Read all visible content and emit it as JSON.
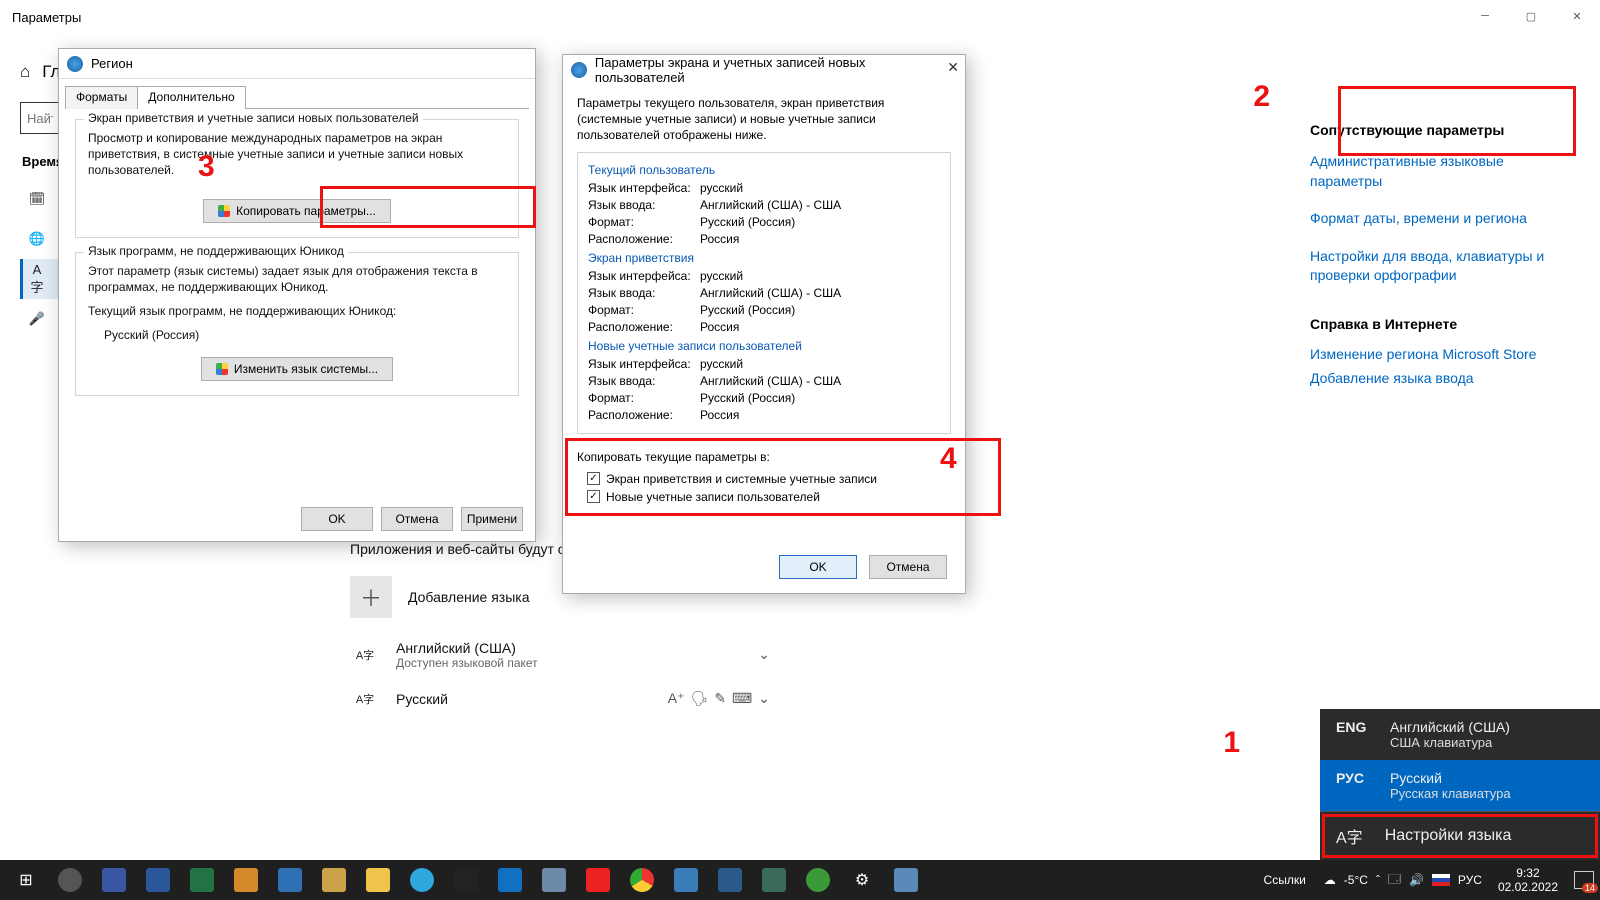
{
  "window": {
    "title": "Параметры",
    "home": "Гл"
  },
  "search": {
    "placeholder": "Найт"
  },
  "nav_heading": "Время",
  "nav": {
    "date": "Да",
    "region": "Ре",
    "lang": "Яз",
    "speech": "Ра"
  },
  "right": {
    "related_h": "Сопутствующие параметры",
    "admin_link": "Административные языковые параметры",
    "date_link": "Формат даты, времени и региона",
    "input_link": "Настройки для ввода, клавиатуры и проверки орфографии",
    "help_h": "Справка в Интернете",
    "store_link": "Изменение региона Microsoft Store",
    "add_lang_link": "Добавление языка ввода"
  },
  "lower": {
    "text": "Приложения и веб-сайты будут о поддерживаемом языке из списк",
    "add_lang": "Добавление языка",
    "lang1": "Английский (США)",
    "lang1_sub": "Доступен языковой пакет",
    "lang2": "Русский"
  },
  "region_dialog": {
    "title": "Регион",
    "tab1": "Форматы",
    "tab2": "Дополнительно",
    "group1_legend": "Экран приветствия и учетные записи новых пользователей",
    "group1_text": "Просмотр и копирование международных параметров на экран приветствия, в системные учетные записи и учетные записи новых пользователей.",
    "copy_btn": "Копировать параметры...",
    "group2_legend": "Язык программ, не поддерживающих Юникод",
    "group2_text": "Этот параметр (язык системы) задает язык для отображения текста в программах, не поддерживающих Юникод.",
    "current_lang_label": "Текущий язык программ, не поддерживающих Юникод:",
    "current_lang_value": "Русский (Россия)",
    "change_btn": "Изменить язык системы...",
    "ok": "OK",
    "cancel": "Отмена",
    "apply": "Примени"
  },
  "accounts_dialog": {
    "title": "Параметры экрана и учетных записей новых пользователей",
    "desc": "Параметры текущего пользователя, экран приветствия (системные учетные записи) и новые учетные записи пользователей отображены ниже.",
    "sec_current": "Текущий пользователь",
    "sec_welcome": "Экран приветствия",
    "sec_new": "Новые учетные записи пользователей",
    "k_ui": "Язык интерфейса:",
    "k_input": "Язык ввода:",
    "k_format": "Формат:",
    "k_loc": "Расположение:",
    "v_ui": "русский",
    "v_input": "Английский (США) - США",
    "v_format": "Русский (Россия)",
    "v_loc": "Россия",
    "copy_label": "Копировать текущие параметры в:",
    "chk1": "Экран приветствия и системные учетные записи",
    "chk2": "Новые учетные записи пользователей",
    "ok": "OK",
    "cancel": "Отмена"
  },
  "lang_popup": {
    "eng_code": "ENG",
    "eng_name": "Английский (США)",
    "eng_sub": "США клавиатура",
    "rus_code": "РУС",
    "rus_name": "Русский",
    "rus_sub": "Русская клавиатура",
    "settings": "Настройки языка"
  },
  "taskbar": {
    "links": "Ссылки",
    "temp": "-5°C",
    "lang": "РУС",
    "time": "9:32",
    "date": "02.02.2022",
    "notif": "14"
  },
  "annotations": {
    "n1": "1",
    "n2": "2",
    "n3": "3",
    "n4": "4"
  }
}
